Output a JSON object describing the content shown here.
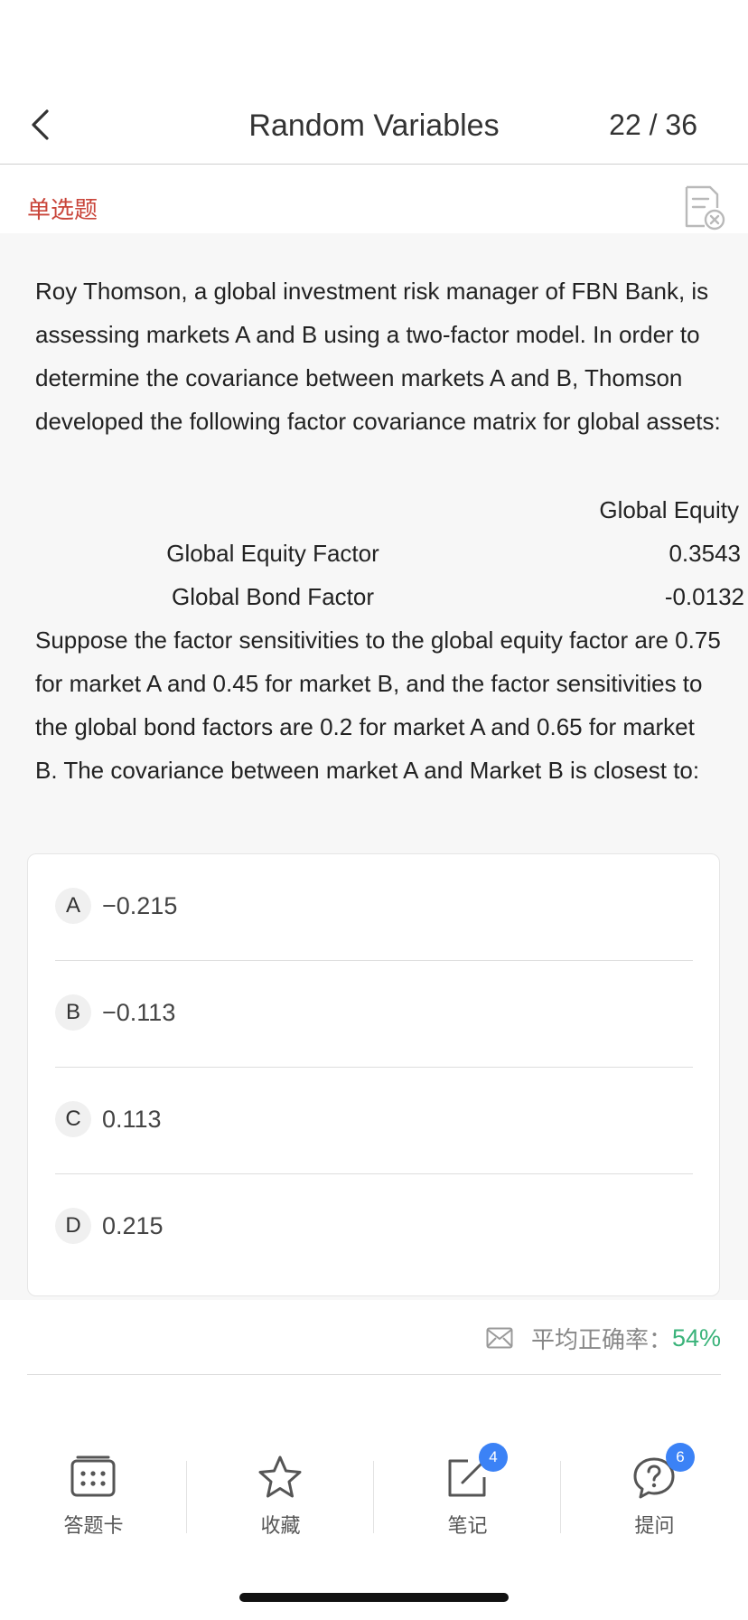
{
  "header": {
    "title": "Random Variables",
    "counter": "22 / 36",
    "back_icon": "chevron-left-icon"
  },
  "question": {
    "type_label": "单选题",
    "report_icon": "report-error-icon",
    "stem_part1": "Roy Thomson, a global investment risk manager of FBN Bank, is assessing markets A and B using a two-factor model. In order to determine the covariance between markets A and B, Thomson developed the following factor covariance matrix for global assets:",
    "matrix": {
      "column_header": "Global Equity",
      "rows": [
        {
          "label": "Global Equity Factor",
          "value": "0.3543"
        },
        {
          "label": "Global Bond Factor",
          "value": "-0.0132"
        }
      ]
    },
    "stem_part2": "Suppose the factor sensitivities to the global equity factor are 0.75 for market A and 0.45 for market B, and the factor sensitivities to the global bond factors are 0.2 for market A and 0.65 for market B. The covariance between market A and Market B is closest to:",
    "options": [
      {
        "letter": "A",
        "text": "−0.215"
      },
      {
        "letter": "B",
        "text": "−0.113"
      },
      {
        "letter": "C",
        "text": "0.113"
      },
      {
        "letter": "D",
        "text": "0.215"
      }
    ]
  },
  "stats": {
    "accuracy_label": "平均正确率：",
    "accuracy_value": "54%",
    "icon": "envelope-icon",
    "accent_color": "#3ab37a"
  },
  "bottom_bar": {
    "tabs": [
      {
        "label": "答题卡",
        "icon": "answer-sheet-icon"
      },
      {
        "label": "收藏",
        "icon": "star-icon"
      },
      {
        "label": "笔记",
        "icon": "note-edit-icon",
        "badge": "4"
      },
      {
        "label": "提问",
        "icon": "question-bubble-icon",
        "badge": "6"
      }
    ]
  }
}
